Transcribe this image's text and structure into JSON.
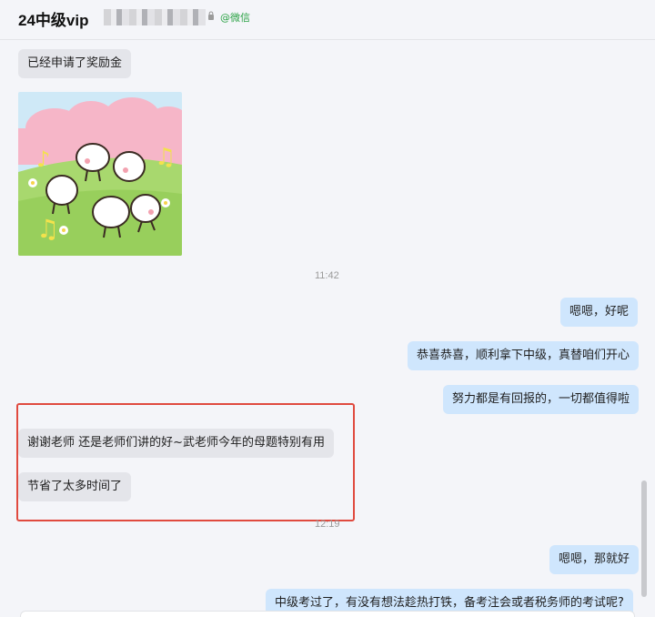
{
  "header": {
    "title": "24中级vip",
    "platform_tag": "@微信"
  },
  "messages": {
    "m1": "已经申请了奖励金",
    "t1": "11:42",
    "m2": "嗯嗯，好呢",
    "m3": "恭喜恭喜，顺利拿下中级，真替咱们开心",
    "m4": "努力都是有回报的，一切都值得啦",
    "m5": "谢谢老师 还是老师们讲的好~武老师今年的母题特别有用",
    "m6": "节省了太多时间了",
    "t2": "12:19",
    "m7": "嗯嗯，那就好",
    "m8": "中级考过了，有没有想法趁热打铁，备考注会或者税务师的考试呢?"
  },
  "colors": {
    "incoming_bubble": "#e4e5ea",
    "outgoing_bubble": "#cfe6fd",
    "highlight": "#e04a3f",
    "wechat_green": "#2ba245"
  },
  "icons": {
    "lock": "lock-icon",
    "sticker": "dancing-sheep-sticker"
  }
}
